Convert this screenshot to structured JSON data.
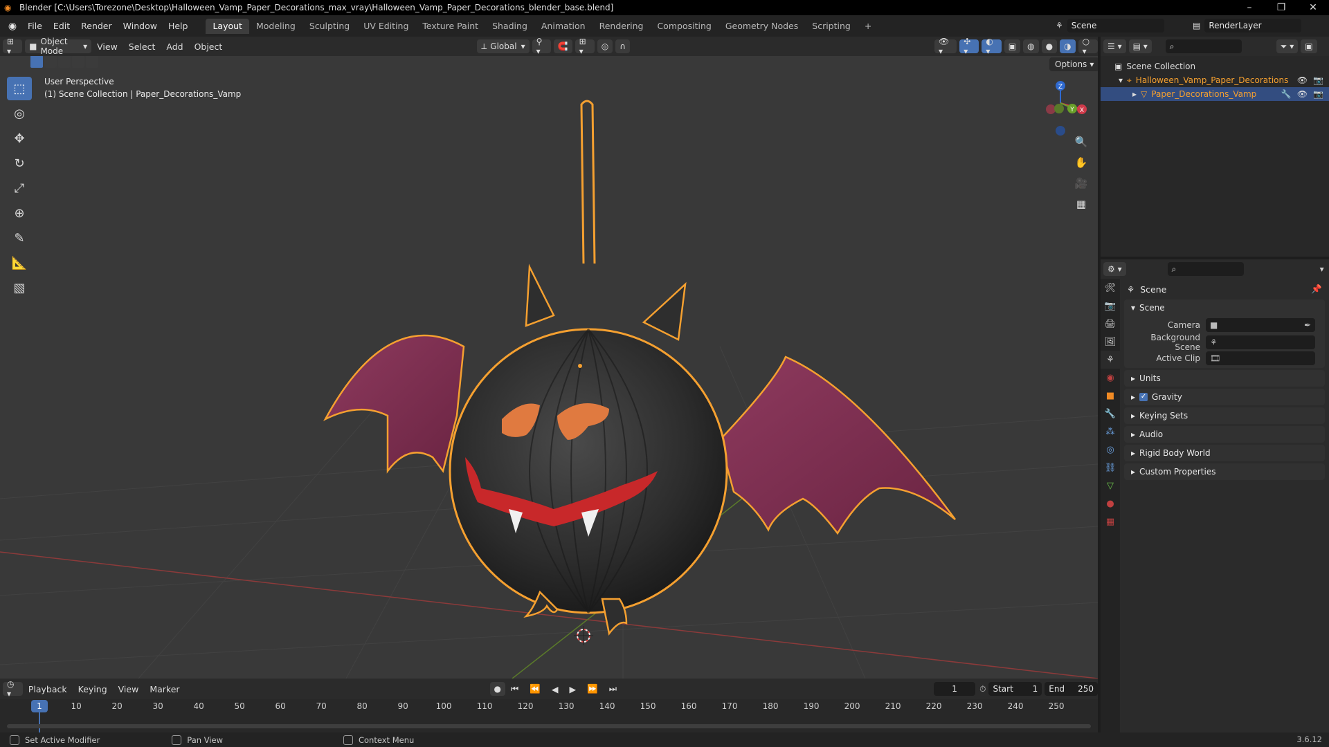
{
  "titlebar": {
    "title": "Blender [C:\\Users\\Torezone\\Desktop\\Halloween_Vamp_Paper_Decorations_max_vray\\Halloween_Vamp_Paper_Decorations_blender_base.blend]"
  },
  "menu": {
    "items": [
      "File",
      "Edit",
      "Render",
      "Window",
      "Help"
    ],
    "tabs": [
      "Layout",
      "Modeling",
      "Sculpting",
      "UV Editing",
      "Texture Paint",
      "Shading",
      "Animation",
      "Rendering",
      "Compositing",
      "Geometry Nodes",
      "Scripting"
    ],
    "active_tab": "Layout",
    "scene": "Scene",
    "render_layer": "RenderLayer"
  },
  "viewport_header": {
    "mode": "Object Mode",
    "menus": [
      "View",
      "Select",
      "Add",
      "Object"
    ],
    "orientation": "Global",
    "options": "Options"
  },
  "viewport": {
    "perspective": "User Perspective",
    "collection_info": "(1) Scene Collection | Paper_Decorations_Vamp"
  },
  "gizmo": {
    "x": "X",
    "y": "Y",
    "z": "Z"
  },
  "timeline": {
    "menus": [
      "Playback",
      "Keying",
      "View",
      "Marker"
    ],
    "current_frame": "1",
    "start_label": "Start",
    "start": "1",
    "end_label": "End",
    "end": "250",
    "ticks": [
      "10",
      "20",
      "30",
      "40",
      "50",
      "60",
      "70",
      "80",
      "90",
      "100",
      "110",
      "120",
      "130",
      "140",
      "150",
      "160",
      "170",
      "180",
      "190",
      "200",
      "210",
      "220",
      "230",
      "240",
      "250"
    ],
    "playhead": "1"
  },
  "status": {
    "left": "Set Active Modifier",
    "middle": "Pan View",
    "right": "Context Menu",
    "version": "3.6.12"
  },
  "outliner": {
    "root": "Scene Collection",
    "collection": "Halloween_Vamp_Paper_Decorations",
    "object": "Paper_Decorations_Vamp"
  },
  "properties": {
    "context": "Scene",
    "panel_title": "Scene",
    "rows": [
      {
        "label": "Camera"
      },
      {
        "label": "Background Scene"
      },
      {
        "label": "Active Clip"
      }
    ],
    "collapsed": [
      "Units",
      "Gravity",
      "Keying Sets",
      "Audio",
      "Rigid Body World",
      "Custom Properties"
    ],
    "gravity_checked": true
  },
  "colors": {
    "accent": "#4772b3",
    "selection_outline": "#f5a030",
    "wing": "#7a2a4a",
    "body": "#2a2a2a"
  }
}
